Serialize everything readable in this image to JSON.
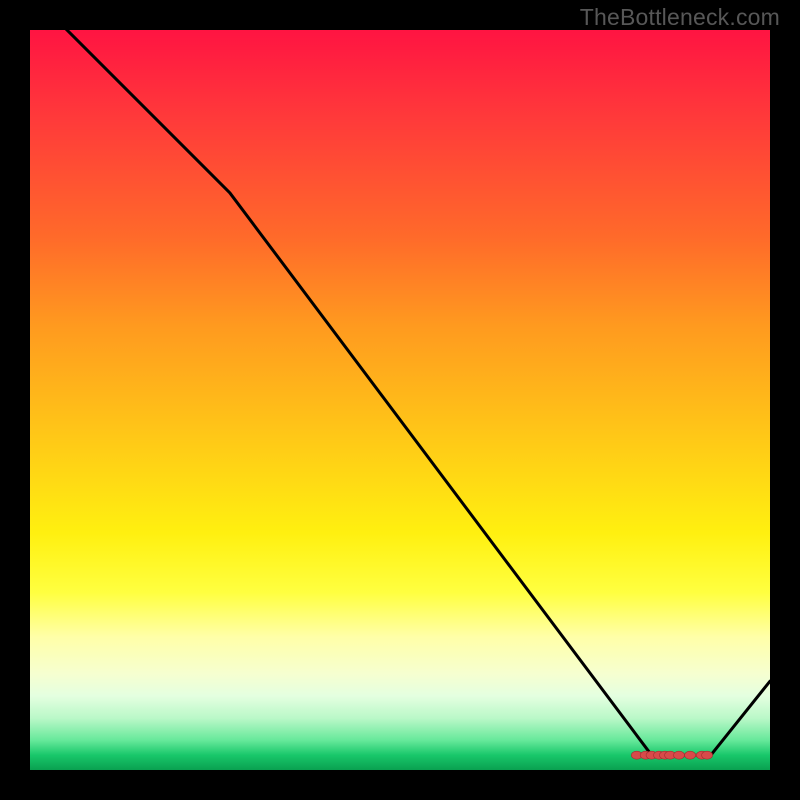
{
  "watermark": "TheBottleneck.com",
  "chart_data": {
    "type": "line",
    "title": "",
    "xlabel": "",
    "ylabel": "",
    "xlim": [
      0,
      100
    ],
    "ylim": [
      0,
      100
    ],
    "grid": false,
    "series": [
      {
        "name": "curve",
        "x": [
          3,
          27,
          84,
          92,
          100
        ],
        "y": [
          102,
          78,
          2,
          2,
          12
        ]
      }
    ],
    "markers": {
      "name": "optimal-range",
      "color": "#d84a4a",
      "points": [
        {
          "x": 82,
          "y": 2
        },
        {
          "x": 83.2,
          "y": 2
        },
        {
          "x": 84.0,
          "y": 2
        },
        {
          "x": 85.0,
          "y": 2
        },
        {
          "x": 85.8,
          "y": 2
        },
        {
          "x": 86.5,
          "y": 2
        },
        {
          "x": 87.7,
          "y": 2
        },
        {
          "x": 89.2,
          "y": 2
        },
        {
          "x": 90.8,
          "y": 2
        },
        {
          "x": 91.5,
          "y": 2
        }
      ]
    },
    "colors": {
      "line": "#000000",
      "marker": "#d84a4a",
      "gradient_top": "#ff1442",
      "gradient_bottom": "#0aa050"
    }
  }
}
